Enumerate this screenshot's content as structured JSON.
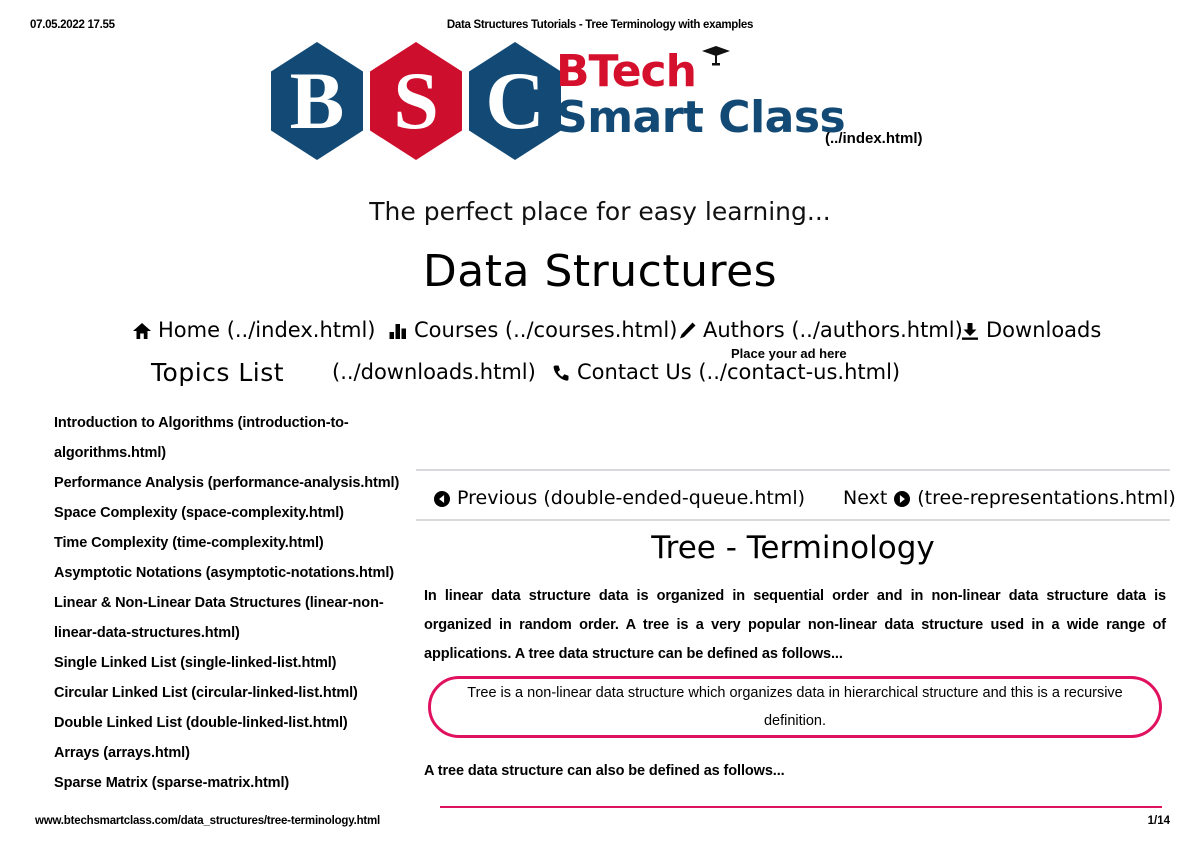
{
  "print_header": {
    "date": "07.05.2022 17.55",
    "title": "Data Structures Tutorials - Tree Terminology with examples"
  },
  "logo": {
    "hex_b": "B",
    "hex_s": "S",
    "hex_c": "C",
    "btech": "BTech",
    "smart_class": "Smart Class",
    "index_link": "(../index.html)",
    "tagline": "The perfect place for easy learning...",
    "colors": {
      "hex_blue": "#124a75",
      "hex_red": "#ce0e2d",
      "btech_red": "#d5102d",
      "smart_blue": "#124a75"
    }
  },
  "page_title": "Data Structures",
  "nav": {
    "home": "Home (../index.html)",
    "courses": "Courses (../courses.html)",
    "authors": "Authors (../authors.html)",
    "downloads": "Downloads",
    "downloads_url": "(../downloads.html)",
    "contact": "Contact Us (../contact-us.html)",
    "ad_text": "Place your ad here",
    "icons": {
      "home": "home-icon",
      "courses": "bar-chart-icon",
      "authors": "pencil-icon",
      "downloads": "download-icon",
      "contact": "phone-icon"
    }
  },
  "sidebar": {
    "heading": "Topics List",
    "items": [
      "Introduction to Algorithms (introduction-to-",
      "algorithms.html)",
      "Performance Analysis (performance-analysis.html)",
      "Space Complexity (space-complexity.html)",
      "Time Complexity (time-complexity.html)",
      "Asymptotic Notations (asymptotic-notations.html)",
      "Linear & Non-Linear Data Structures (linear-non-",
      "linear-data-structures.html)",
      "Single Linked List (single-linked-list.html)",
      "Circular Linked List (circular-linked-list.html)",
      "Double Linked List (double-linked-list.html)",
      "Arrays (arrays.html)",
      "Sparse Matrix (sparse-matrix.html)"
    ]
  },
  "pager": {
    "previous": "Previous (double-ended-queue.html)",
    "next_label": "Next",
    "next_url": "(tree-representations.html)"
  },
  "article": {
    "title": "Tree - Terminology",
    "paragraph_1": "In linear data structure data is organized in sequential order and in non-linear data structure data is organized in random order. A tree is a very popular non-linear data structure used in a wide range of applications. A tree data structure can be defined as follows...",
    "callout_line_1": "Tree is a non-linear data structure which organizes data in hierarchical structure and this is a recursive",
    "callout_line_2": "definition.",
    "callout_border_color": "#e0115f",
    "paragraph_2": "A tree data structure can also be defined as follows..."
  },
  "footer": {
    "url": "www.btechsmartclass.com/data_structures/tree-terminology.html",
    "page": "1/14"
  }
}
